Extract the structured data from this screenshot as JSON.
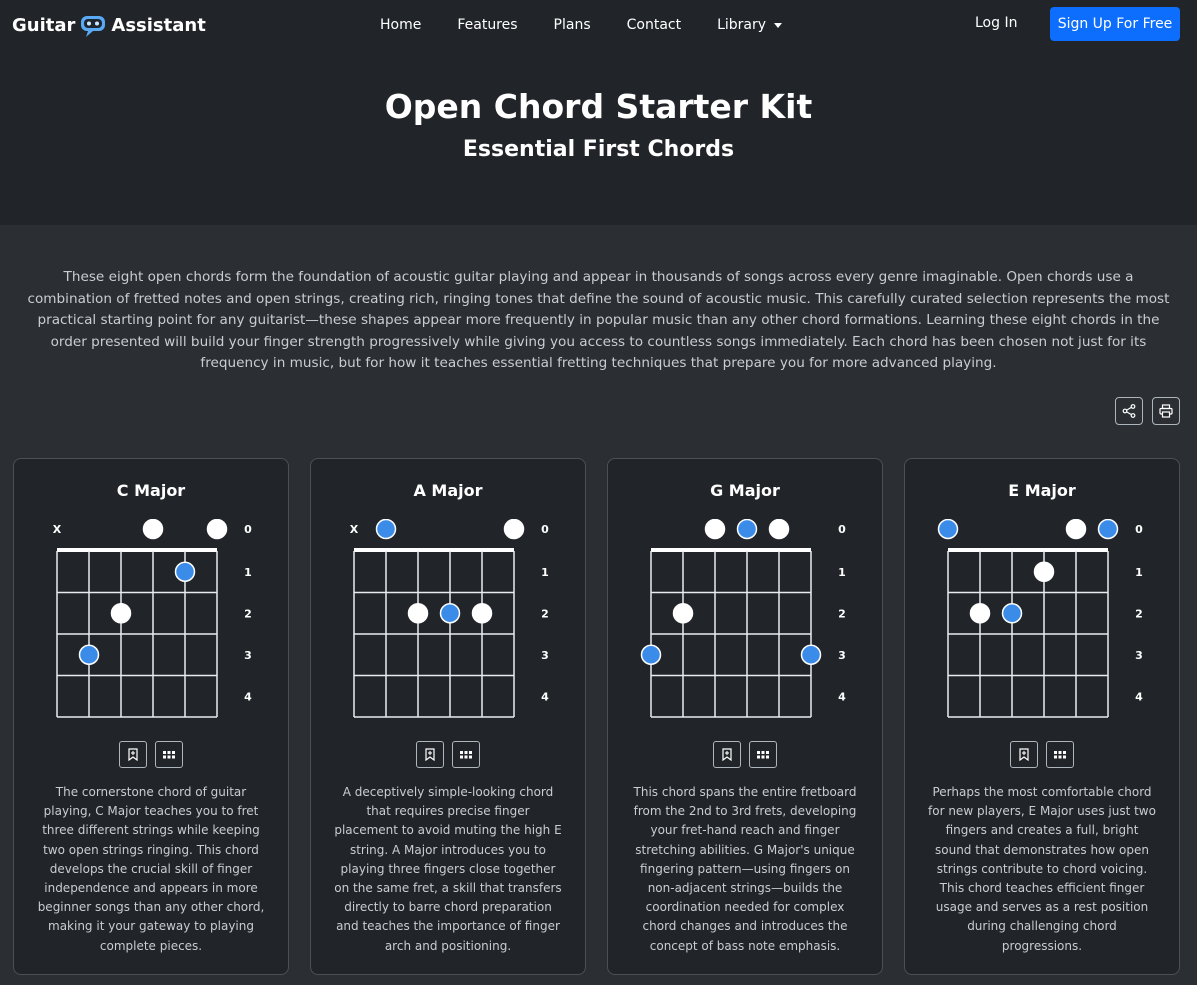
{
  "nav": {
    "brand_left": "Guitar",
    "brand_right": "Assistant",
    "links": [
      "Home",
      "Features",
      "Plans",
      "Contact",
      "Library"
    ],
    "login": "Log In",
    "signup": "Sign Up For Free"
  },
  "hero": {
    "title": "Open Chord Starter Kit",
    "subtitle": "Essential First Chords"
  },
  "intro": "These eight open chords form the foundation of acoustic guitar playing and appear in thousands of songs across every genre imaginable. Open chords use a combination of fretted notes and open strings, creating rich, ringing tones that define the sound of acoustic music. This carefully curated selection represents the most practical starting point for any guitarist—these shapes appear more frequently in popular music than any other chord formations. Learning these eight chords in the order presented will build your finger strength progressively while giving you access to countless songs immediately. Each chord has been chosen not just for its frequency in music, but for how it teaches essential fretting techniques that prepare you for more advanced playing.",
  "icons": {
    "share": "share-icon",
    "print": "printer-icon",
    "bookmark": "bookmark-icon",
    "grid": "grid-icon"
  },
  "colors": {
    "accent": "#0d6efd",
    "dot_blue": "#3b8ce9",
    "dot_white": "#ffffff"
  },
  "fret_labels": [
    "0",
    "1",
    "2",
    "3",
    "4"
  ],
  "chords": [
    {
      "name": "C Major",
      "muted": [
        0
      ],
      "notes": [
        {
          "string": 1,
          "fret": 3,
          "root": true
        },
        {
          "string": 2,
          "fret": 2,
          "root": false
        },
        {
          "string": 3,
          "fret": 0,
          "root": false
        },
        {
          "string": 4,
          "fret": 1,
          "root": true
        },
        {
          "string": 5,
          "fret": 0,
          "root": false
        }
      ],
      "description": "The cornerstone chord of guitar playing, C Major teaches you to fret three different strings while keeping two open strings ringing. This chord develops the crucial skill of finger independence and appears in more beginner songs than any other chord, making it your gateway to playing complete pieces."
    },
    {
      "name": "A Major",
      "muted": [
        0
      ],
      "notes": [
        {
          "string": 1,
          "fret": 0,
          "root": true
        },
        {
          "string": 2,
          "fret": 2,
          "root": false
        },
        {
          "string": 3,
          "fret": 2,
          "root": true
        },
        {
          "string": 4,
          "fret": 2,
          "root": false
        },
        {
          "string": 5,
          "fret": 0,
          "root": false
        }
      ],
      "description": "A deceptively simple-looking chord that requires precise finger placement to avoid muting the high E string. A Major introduces you to playing three fingers close together on the same fret, a skill that transfers directly to barre chord preparation and teaches the importance of finger arch and positioning."
    },
    {
      "name": "G Major",
      "muted": [],
      "notes": [
        {
          "string": 0,
          "fret": 3,
          "root": true
        },
        {
          "string": 1,
          "fret": 2,
          "root": false
        },
        {
          "string": 2,
          "fret": 0,
          "root": false
        },
        {
          "string": 3,
          "fret": 0,
          "root": true
        },
        {
          "string": 4,
          "fret": 0,
          "root": false
        },
        {
          "string": 5,
          "fret": 3,
          "root": true
        }
      ],
      "description": "This chord spans the entire fretboard from the 2nd to 3rd frets, developing your fret-hand reach and finger stretching abilities. G Major's unique fingering pattern—using fingers on non-adjacent strings—builds the coordination needed for complex chord changes and introduces the concept of bass note emphasis."
    },
    {
      "name": "E Major",
      "muted": [],
      "notes": [
        {
          "string": 0,
          "fret": 0,
          "root": true
        },
        {
          "string": 1,
          "fret": 2,
          "root": false
        },
        {
          "string": 2,
          "fret": 2,
          "root": true
        },
        {
          "string": 3,
          "fret": 1,
          "root": false
        },
        {
          "string": 4,
          "fret": 0,
          "root": false
        },
        {
          "string": 5,
          "fret": 0,
          "root": true
        }
      ],
      "description": "Perhaps the most comfortable chord for new players, E Major uses just two fingers and creates a full, bright sound that demonstrates how open strings contribute to chord voicing. This chord teaches efficient finger usage and serves as a rest position during challenging chord progressions."
    }
  ]
}
